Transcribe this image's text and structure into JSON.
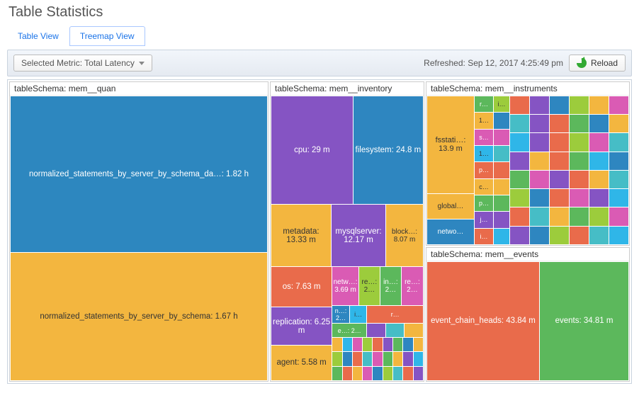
{
  "page_title": "Table Statistics",
  "tabs": {
    "table_view": "Table View",
    "treemap_view": "Treemap View",
    "active": "treemap_view"
  },
  "toolbar": {
    "metric_label": "Selected Metric: Total Latency",
    "refreshed_label": "Refreshed: Sep 12, 2017 4:25:49 pm",
    "reload_label": "Reload"
  },
  "groups": {
    "quan": {
      "header": "tableSchema: mem__quan",
      "cells": {
        "top": "normalized_statements_by_server_by_schema_da…: 1.82 h",
        "bottom": "normalized_statements_by_server_by_schema: 1.67 h"
      }
    },
    "inventory": {
      "header": "tableSchema: mem__inventory",
      "cells": {
        "cpu": "cpu: 29 m",
        "fs": "filesystem: 24.8 m",
        "metadata": "metadata: 13.33 m",
        "mysql": "mysqlserver: 12.17 m",
        "block": "block…: 8.07 m",
        "os": "os: 7.63 m",
        "netw": "netw…: 3.69 m",
        "re1": "re…: 2…",
        "in": "in…: 2…",
        "re2": "re…: 2…",
        "n2": "n…: 2…",
        "i": "i…",
        "r": "r…",
        "e2": "e…: 2…",
        "replication": "replication: 6.25 m",
        "agent": "agent: 5.58 m"
      }
    },
    "instruments": {
      "header": "tableSchema: mem__instruments",
      "cells": {
        "fsstat": "fsstati…: 13.9 m",
        "global": "global…",
        "netwo": "netwo…",
        "r": "r…",
        "i": "i…",
        "one": "1…",
        "s": "s…",
        "p": "p…",
        "c": "c…",
        "p2": "p…",
        "j": "j…",
        "i2": "i…"
      }
    },
    "events": {
      "header": "tableSchema: mem__events",
      "cells": {
        "chain": "event_chain_heads: 43.84 m",
        "events": "events: 34.81 m"
      }
    }
  },
  "chart_data": {
    "type": "treemap",
    "metric": "Total Latency",
    "groups": [
      {
        "schema": "mem__quan",
        "tables": [
          {
            "name": "normalized_statements_by_server_by_schema_da…",
            "value": 1.82,
            "unit": "h"
          },
          {
            "name": "normalized_statements_by_server_by_schema",
            "value": 1.67,
            "unit": "h"
          }
        ]
      },
      {
        "schema": "mem__inventory",
        "tables": [
          {
            "name": "cpu",
            "value": 29,
            "unit": "m"
          },
          {
            "name": "filesystem",
            "value": 24.8,
            "unit": "m"
          },
          {
            "name": "metadata",
            "value": 13.33,
            "unit": "m"
          },
          {
            "name": "mysqlserver",
            "value": 12.17,
            "unit": "m"
          },
          {
            "name": "block…",
            "value": 8.07,
            "unit": "m"
          },
          {
            "name": "os",
            "value": 7.63,
            "unit": "m"
          },
          {
            "name": "netw…",
            "value": 3.69,
            "unit": "m"
          },
          {
            "name": "replication",
            "value": 6.25,
            "unit": "m"
          },
          {
            "name": "agent",
            "value": 5.58,
            "unit": "m"
          },
          {
            "name": "re…",
            "value": 2,
            "unit": "m"
          },
          {
            "name": "in…",
            "value": 2,
            "unit": "m"
          },
          {
            "name": "re…",
            "value": 2,
            "unit": "m"
          },
          {
            "name": "n…",
            "value": 2,
            "unit": "m"
          },
          {
            "name": "e…",
            "value": 2,
            "unit": "m"
          }
        ]
      },
      {
        "schema": "mem__instruments",
        "tables": [
          {
            "name": "fsstati…",
            "value": 13.9,
            "unit": "m"
          },
          {
            "name": "global…",
            "value": null,
            "unit": "m"
          },
          {
            "name": "netwo…",
            "value": null,
            "unit": "m"
          }
        ]
      },
      {
        "schema": "mem__events",
        "tables": [
          {
            "name": "event_chain_heads",
            "value": 43.84,
            "unit": "m"
          },
          {
            "name": "events",
            "value": 34.81,
            "unit": "m"
          }
        ]
      }
    ]
  }
}
